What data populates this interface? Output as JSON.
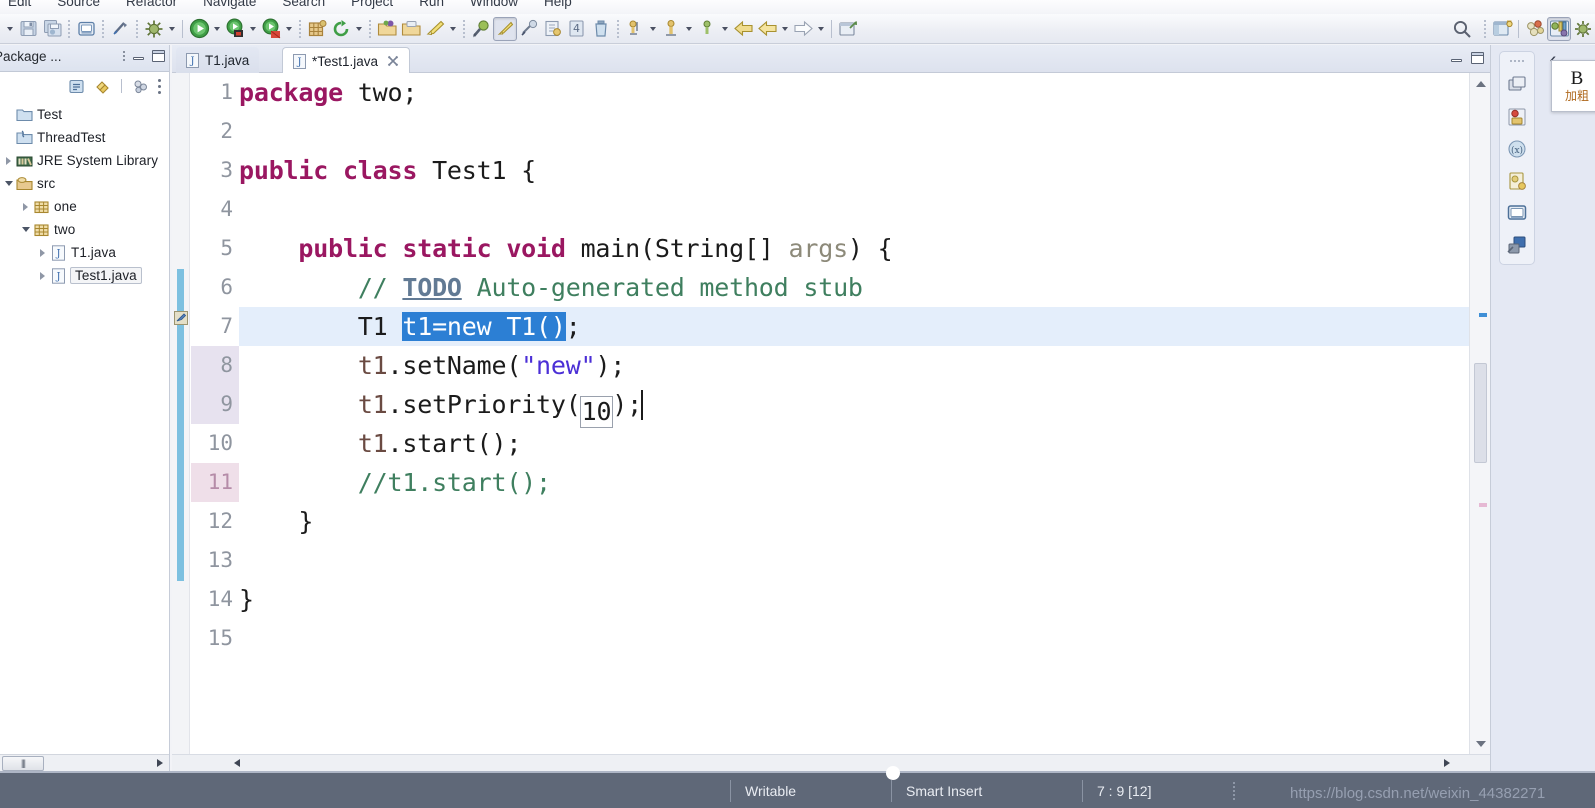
{
  "menu": {
    "items": [
      "Edit",
      "Source",
      "Refactor",
      "Navigate",
      "Search",
      "Project",
      "Run",
      "Window",
      "Help"
    ]
  },
  "toolbar": {
    "icons": [
      "save-icon",
      "save-all-icon",
      "print-icon",
      "link-break-icon",
      "debug-icon",
      "run-icon",
      "run-as-icon",
      "run-coverage-icon",
      "build-icon",
      "refresh-icon",
      "new-package-icon",
      "open-type-icon",
      "marker-icon",
      "search-type-icon",
      "pin-icon",
      "edit-icon",
      "next-annotation-icon",
      "previous-annotation-icon",
      "last-edit-icon",
      "back-icon",
      "forward-icon",
      "external-tools-icon"
    ],
    "search_label": "search-icon",
    "perspective_java_label": "java-perspective-icon",
    "perspective_debug_label": "debug-perspective-icon",
    "open-perspective_label": "open-perspective-icon"
  },
  "package_explorer": {
    "title": "Package ...",
    "toolbar_icons": [
      "collapse-all-icon",
      "link-with-editor-icon",
      "view-menu-icon",
      "view-dots-icon"
    ],
    "tree": [
      {
        "label": "Test",
        "indent": 0,
        "arrow": "none",
        "icon": "project-icon"
      },
      {
        "label": "ThreadTest",
        "indent": 0,
        "arrow": "none",
        "icon": "java-project-icon"
      },
      {
        "label": "JRE System Library",
        "indent": 0,
        "arrow": "collapsed",
        "icon": "library-icon"
      },
      {
        "label": "src",
        "indent": 0,
        "arrow": "expanded",
        "icon": "source-folder-icon"
      },
      {
        "label": "one",
        "indent": 1,
        "arrow": "collapsed",
        "icon": "package-icon"
      },
      {
        "label": "two",
        "indent": 1,
        "arrow": "expanded",
        "icon": "package-icon"
      },
      {
        "label": "T1.java",
        "indent": 2,
        "arrow": "collapsed",
        "icon": "java-file-icon"
      },
      {
        "label": "Test1.java",
        "indent": 2,
        "arrow": "collapsed",
        "icon": "java-file-icon",
        "selected": true
      }
    ]
  },
  "editor": {
    "tabs": [
      {
        "label": "T1.java",
        "active": false,
        "dirty": false,
        "closeable": false
      },
      {
        "label": "*Test1.java",
        "active": true,
        "dirty": true,
        "closeable": true
      }
    ],
    "lines": [
      {
        "n": "1",
        "tokens": [
          {
            "t": "package",
            "c": "kw"
          },
          {
            "t": " two;",
            "c": ""
          }
        ]
      },
      {
        "n": "2",
        "tokens": []
      },
      {
        "n": "3",
        "tokens": [
          {
            "t": "public class",
            "c": "kw"
          },
          {
            "t": " Test1 {",
            "c": ""
          }
        ]
      },
      {
        "n": "4",
        "tokens": []
      },
      {
        "n": "5",
        "fold": true,
        "tokens": [
          {
            "t": "    ",
            "c": ""
          },
          {
            "t": "public static void",
            "c": "kw"
          },
          {
            "t": " main(String[] ",
            "c": ""
          },
          {
            "t": "args",
            "c": "prm"
          },
          {
            "t": ") {",
            "c": ""
          }
        ]
      },
      {
        "n": "6",
        "marker": "todo",
        "tokens": [
          {
            "t": "        ",
            "c": ""
          },
          {
            "t": "// ",
            "c": "cmt"
          },
          {
            "t": "TODO",
            "c": "todo"
          },
          {
            "t": " Auto-generated method stub",
            "c": "cmt"
          }
        ]
      },
      {
        "n": "7",
        "current": true,
        "tokens": [
          {
            "t": "        T1 ",
            "c": ""
          },
          {
            "t": "t1=new T1()",
            "c": "sel"
          },
          {
            "t": ";",
            "c": ""
          }
        ]
      },
      {
        "n": "8",
        "numbg": "lav",
        "tokens": [
          {
            "t": "        ",
            "c": ""
          },
          {
            "t": "t1",
            "c": "fld"
          },
          {
            "t": ".setName(",
            "c": ""
          },
          {
            "t": "\"new\"",
            "c": "str"
          },
          {
            "t": ");",
            "c": ""
          }
        ]
      },
      {
        "n": "9",
        "numbg": "lav",
        "boxed": "10",
        "tokens": [
          {
            "t": "        ",
            "c": ""
          },
          {
            "t": "t1",
            "c": "fld"
          },
          {
            "t": ".setPriority(",
            "c": ""
          }
        ],
        "tail": [
          {
            "t": ");",
            "c": ""
          }
        ]
      },
      {
        "n": "10",
        "tokens": [
          {
            "t": "        ",
            "c": ""
          },
          {
            "t": "t1",
            "c": "fld"
          },
          {
            "t": ".start();",
            "c": ""
          }
        ]
      },
      {
        "n": "11",
        "numbg": "pink",
        "tokens": [
          {
            "t": "        //t1.start();",
            "c": "cmt"
          }
        ]
      },
      {
        "n": "12",
        "tokens": [
          {
            "t": "    }",
            "c": ""
          }
        ]
      },
      {
        "n": "13",
        "tokens": []
      },
      {
        "n": "14",
        "tokens": [
          {
            "t": "}",
            "c": ""
          }
        ]
      },
      {
        "n": "15",
        "tokens": []
      }
    ]
  },
  "right_bar": {
    "icons": [
      "restore-icon",
      "debug-view-icon",
      "variables-view-icon",
      "snippets-view-icon",
      "console-view-icon",
      "servers-view-icon"
    ],
    "collapse_label": "‹"
  },
  "tooltip": {
    "bold_glyph": "B",
    "text": "加粗"
  },
  "status_bar": {
    "writable": "Writable",
    "insert_mode": "Smart Insert",
    "position": "7 : 9 [12]"
  },
  "watermark": {
    "text": "https://blog.csdn.net/weixin_44382271"
  },
  "colors": {
    "keyword": "#9a1761",
    "string": "#4b2fd6",
    "comment": "#3f7f5f",
    "selection": "#2c7fd4",
    "current_line": "#e4eefb",
    "status_bg": "#5f6878"
  }
}
